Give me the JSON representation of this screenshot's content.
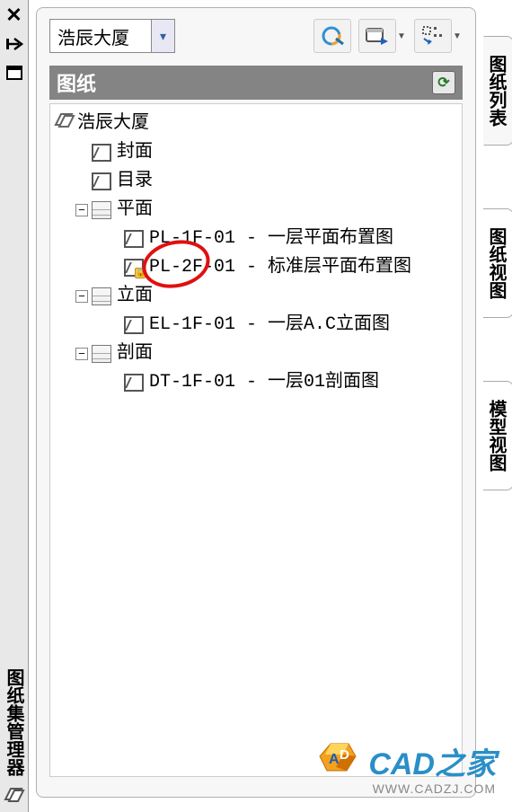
{
  "panel_vertical_title": "图纸集管理器",
  "toolbar": {
    "dropdown_value": "浩辰大厦"
  },
  "header": {
    "title": "图纸",
    "refresh_glyph": "⟳"
  },
  "tree": {
    "root": "浩辰大厦",
    "items": [
      {
        "label": "封面"
      },
      {
        "label": "目录"
      }
    ],
    "group_plan": {
      "label": "平面",
      "children": [
        "PL-1F-01 - 一层平面布置图",
        "PL-2F-01 - 标准层平面布置图"
      ]
    },
    "group_elev": {
      "label": "立面",
      "children": [
        "EL-1F-01 - 一层A.C立面图"
      ]
    },
    "group_sect": {
      "label": "剖面",
      "children": [
        "DT-1F-01 - 一层01剖面图"
      ]
    }
  },
  "tabs": {
    "t1": "图纸列表",
    "t2": "图纸视图",
    "t3": "模型视图"
  },
  "watermark": {
    "text": "CAD之家",
    "url": "WWW.CADZJ.COM"
  }
}
